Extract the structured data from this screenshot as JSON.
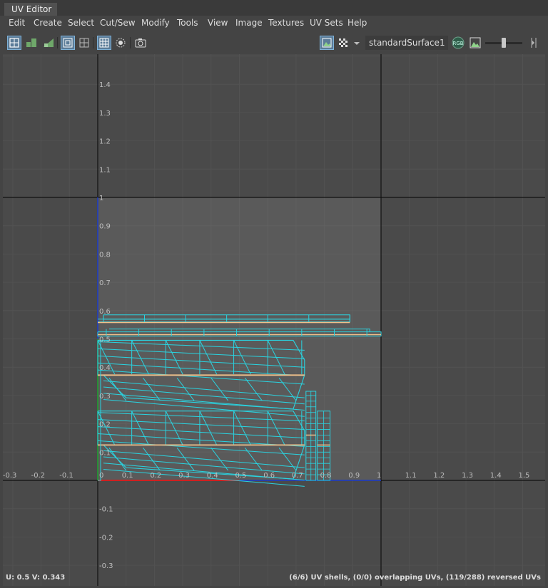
{
  "window": {
    "title": "UV Editor"
  },
  "menu": [
    "Edit",
    "Create",
    "Select",
    "Cut/Sew",
    "Modify",
    "Tools",
    "View",
    "Image",
    "Textures",
    "UV Sets",
    "Help"
  ],
  "toolbar": {
    "shader": "standardSurface1",
    "rgb_label": "RGB",
    "exposure_level": 0.5
  },
  "axes": {
    "u_ticks": [
      "-0.3",
      "-0.2",
      "-0.1",
      "0",
      "0.1",
      "0.2",
      "0.3",
      "0.4",
      "0.5",
      "0.6",
      "0.7",
      "0.8",
      "0.9",
      "1",
      "1.1",
      "1.2",
      "1.3",
      "1.4",
      "1.5"
    ],
    "v_ticks": [
      "1.4",
      "1.3",
      "1.2",
      "1.1",
      "1",
      "0.9",
      "0.8",
      "0.7",
      "0.6",
      "0.5",
      "0.4",
      "0.3",
      "0.2",
      "0.1",
      "-0.1",
      "-0.2",
      "-0.3"
    ]
  },
  "status": {
    "coords": "U:  0.5 V:  0.343",
    "summary": "(6/6) UV shells, (0/0) overlapping UVs, (119/288) reversed UVs"
  },
  "colors": {
    "wire": "#2ad3e0",
    "seam": "#f0c08a",
    "u_axis": "#d02020",
    "v_axis": "#2040d0",
    "grid": "#555555",
    "uv_tile": "#5a5a5a"
  }
}
